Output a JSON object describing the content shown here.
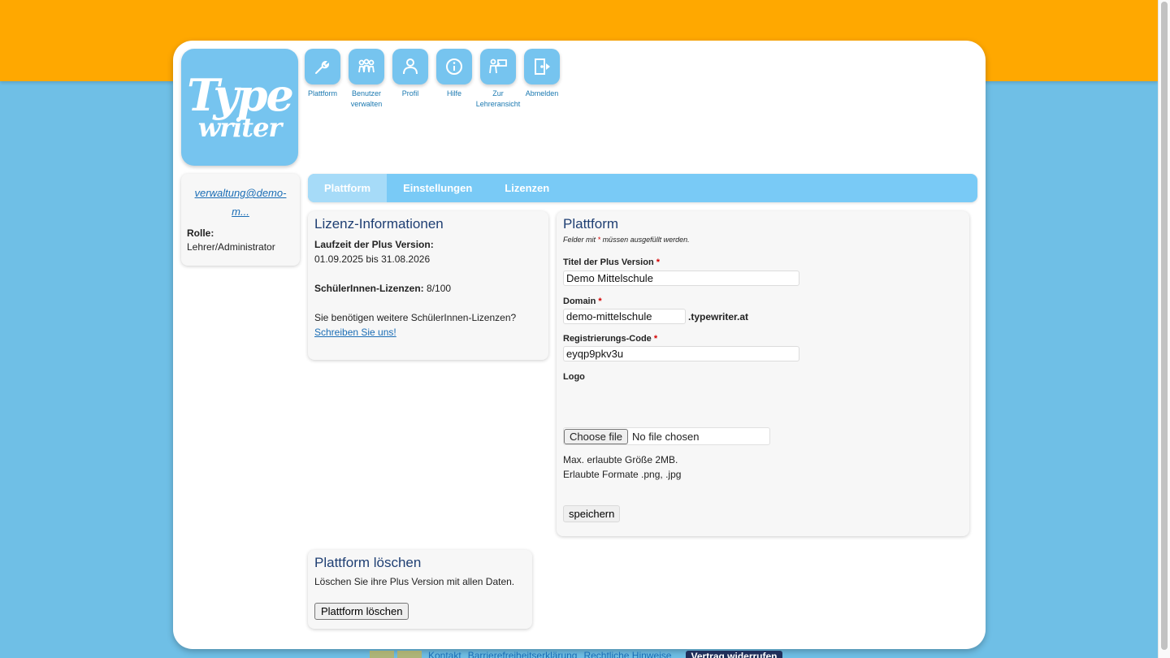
{
  "logo": {
    "line1": "Type",
    "line2": "writer"
  },
  "nav": [
    {
      "label": "Plattform",
      "icon": "wrench-icon"
    },
    {
      "label": "Benutzer verwalten",
      "icon": "users-icon"
    },
    {
      "label": "Profil",
      "icon": "person-icon"
    },
    {
      "label": "Hilfe",
      "icon": "info-icon"
    },
    {
      "label": "Zur Lehreransicht",
      "icon": "teacher-icon"
    },
    {
      "label": "Abmelden",
      "icon": "logout-icon"
    }
  ],
  "user": {
    "email": "verwaltung@demo-m...",
    "role_label": "Rolle:",
    "role": "Lehrer/Administrator"
  },
  "tabs": [
    "Plattform",
    "Einstellungen",
    "Lizenzen"
  ],
  "license": {
    "title": "Lizenz-Informationen",
    "runtime_label": "Laufzeit der Plus Version:",
    "runtime": "01.09.2025 bis 31.08.2026",
    "students_label": "SchülerInnen-Lizenzen:",
    "students_value": "8/100",
    "more_text": "Sie benötigen weitere SchülerInnen-Lizenzen?",
    "contact_link": "Schreiben Sie uns!"
  },
  "platform": {
    "title": "Plattform",
    "note_prefix": "Felder mit",
    "note_star": "*",
    "note_suffix": "müssen ausgefüllt werden.",
    "title_label": "Titel der Plus Version",
    "title_value": "Demo Mittelschule",
    "domain_label": "Domain",
    "domain_value": "demo-mittelschule",
    "domain_suffix": ".typewriter.at",
    "code_label": "Registrierungs-Code",
    "code_value": "eyqp9pkv3u",
    "logo_label": "Logo",
    "file_button": "Choose file",
    "file_status": "No file chosen",
    "max_size": "Max. erlaubte Größe 2MB.",
    "formats": "Erlaubte Formate .png, .jpg",
    "save_label": "speichern",
    "required_star": "*"
  },
  "delete": {
    "title": "Plattform löschen",
    "text": "Löschen Sie ihre Plus Version mit allen Daten.",
    "button": "Plattform löschen"
  },
  "footer": {
    "links": [
      "Kontakt",
      "Barrierefreiheitserklärung",
      "Rechtliche Hinweise"
    ],
    "revoke": "Vertrag widerrufen"
  },
  "colors": {
    "orange": "#ffa800",
    "sky": "#6fbfe6",
    "accent": "#76c4ef",
    "link": "#1a6db5"
  }
}
